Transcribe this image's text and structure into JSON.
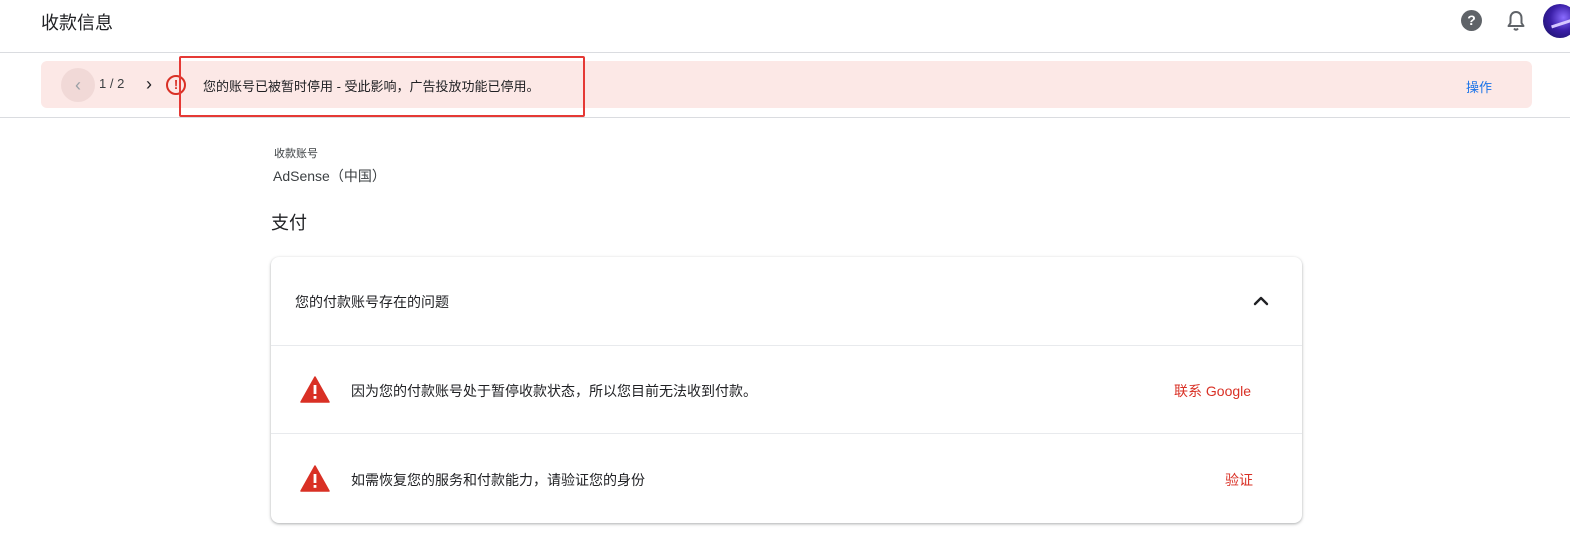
{
  "header": {
    "title": "收款信息",
    "help_icon": "help-icon",
    "help_glyph": "?",
    "notifications_icon": "bell-icon",
    "avatar_icon": "avatar"
  },
  "banner": {
    "prev_glyph": "‹",
    "pager": "1 / 2",
    "next_glyph": "›",
    "alert_glyph": "!",
    "message": "您的账号已被暂时停用 - 受此影响，广告投放功能已停用。",
    "action_label": "操作",
    "background_color": "#fce8e6",
    "highlight_color": "#e53935"
  },
  "account": {
    "label": "收款账号",
    "value": "AdSense（中国）"
  },
  "payments": {
    "section_title": "支付",
    "card_title": "您的付款账号存在的问题",
    "issues": [
      {
        "icon": "warning-icon",
        "text": "因为您的付款账号处于暂停收款状态，所以您目前无法收到付款。",
        "action": "联系 Google"
      },
      {
        "icon": "warning-icon",
        "text": "如需恢复您的服务和付款能力，请验证您的身份",
        "action": "验证"
      }
    ],
    "warning_color": "#d93025"
  }
}
